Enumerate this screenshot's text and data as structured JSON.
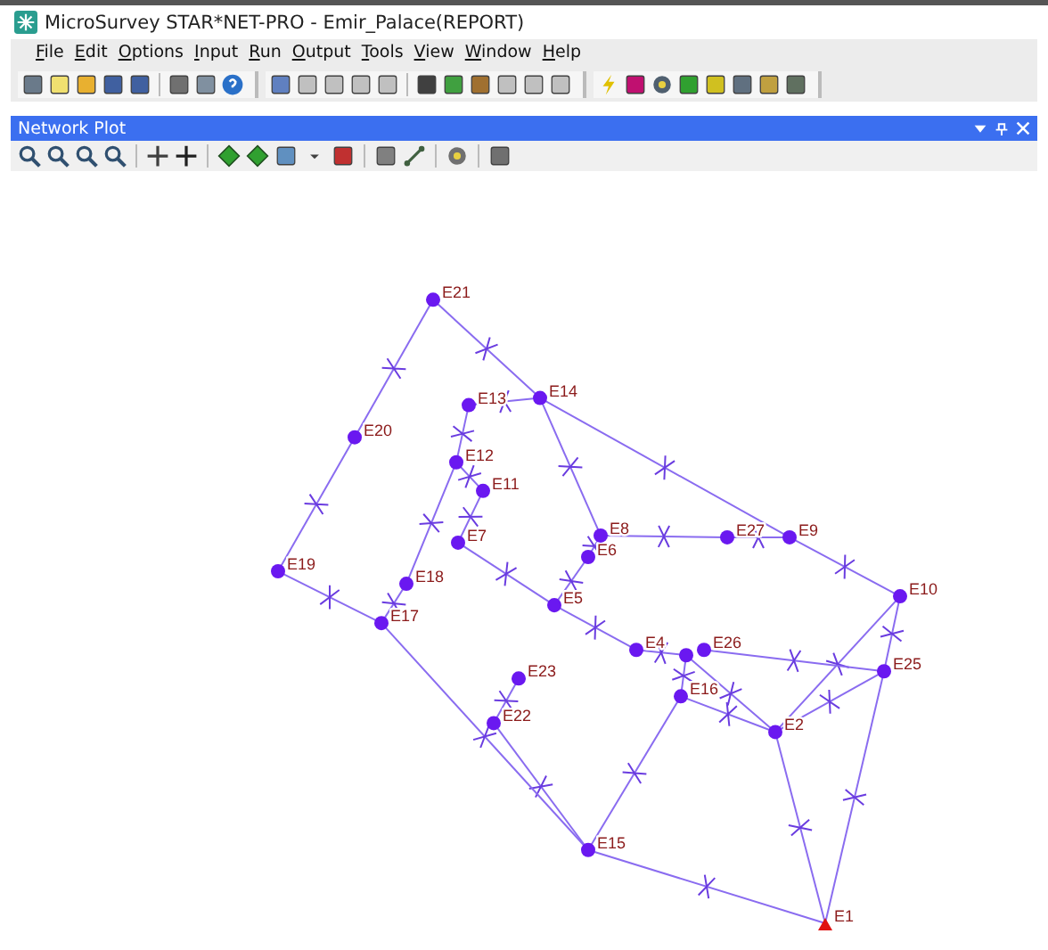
{
  "window": {
    "title": "MicroSurvey STAR*NET-PRO - Emir_Palace(REPORT)"
  },
  "menu": [
    {
      "label": "File"
    },
    {
      "label": "Edit"
    },
    {
      "label": "Options"
    },
    {
      "label": "Input"
    },
    {
      "label": "Run"
    },
    {
      "label": "Output"
    },
    {
      "label": "Tools"
    },
    {
      "label": "View"
    },
    {
      "label": "Window"
    },
    {
      "label": "Help"
    }
  ],
  "panel": {
    "title": "Network Plot"
  },
  "plot": {
    "points": [
      {
        "label": "E21",
        "kind": "station"
      },
      {
        "label": "E20",
        "kind": "station"
      },
      {
        "label": "E19",
        "kind": "station"
      },
      {
        "label": "E17",
        "kind": "station"
      },
      {
        "label": "E18",
        "kind": "station"
      },
      {
        "label": "E12",
        "kind": "station"
      },
      {
        "label": "E13",
        "kind": "station"
      },
      {
        "label": "E14",
        "kind": "station"
      },
      {
        "label": "E11",
        "kind": "station"
      },
      {
        "label": "E7",
        "kind": "station"
      },
      {
        "label": "E5",
        "kind": "station"
      },
      {
        "label": "E6",
        "kind": "station"
      },
      {
        "label": "E8",
        "kind": "station"
      },
      {
        "label": "E27",
        "kind": "station"
      },
      {
        "label": "E9",
        "kind": "station"
      },
      {
        "label": "E10",
        "kind": "station"
      },
      {
        "label": "E25",
        "kind": "station"
      },
      {
        "label": "E4",
        "kind": "station"
      },
      {
        "kind": "station"
      },
      {
        "label": "E26",
        "kind": "station"
      },
      {
        "label": "E16",
        "kind": "station"
      },
      {
        "label": "E2",
        "kind": "station"
      },
      {
        "label": "E23",
        "kind": "station"
      },
      {
        "label": "E22",
        "kind": "station"
      },
      {
        "label": "E15",
        "kind": "station"
      },
      {
        "label": "E1",
        "kind": "control"
      }
    ]
  }
}
